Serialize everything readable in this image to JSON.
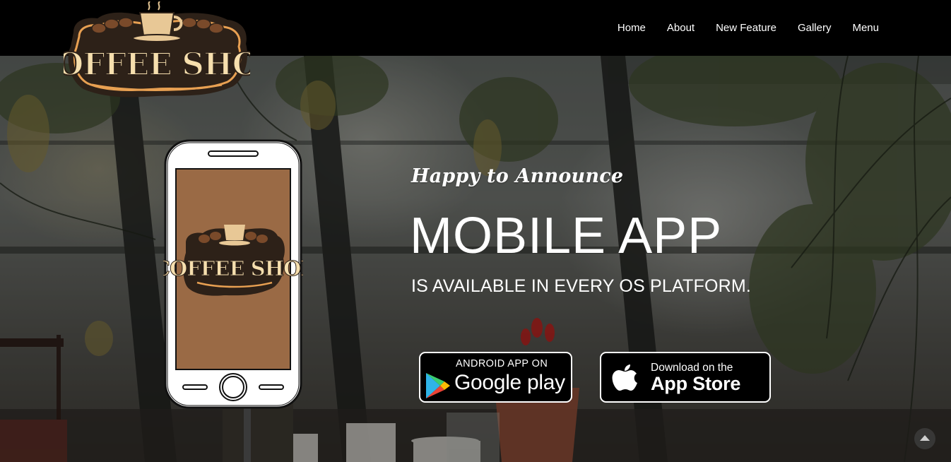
{
  "brand": {
    "logo_text": "COFFEE SHOP"
  },
  "nav": {
    "items": [
      {
        "label": "Home"
      },
      {
        "label": "About"
      },
      {
        "label": "New Feature"
      },
      {
        "label": "Gallery"
      },
      {
        "label": "Menu"
      }
    ]
  },
  "hero": {
    "kicker": "Happy to Announce",
    "headline": "MOBILE APP",
    "subline": "IS AVAILABLE IN EVERY OS PLATFORM."
  },
  "badges": {
    "google": {
      "small": "ANDROID APP ON",
      "big": "Google play",
      "icon": "google-play-icon"
    },
    "apple": {
      "small": "Download on the",
      "big": "App Store",
      "icon": "apple-icon"
    }
  },
  "phone": {
    "screen_logo_text": "COFFEE SHOP"
  },
  "scroll_top": {
    "icon": "chevron-up-icon"
  },
  "colors": {
    "nav_bg": "#000000",
    "phone_screen": "#9a6a45",
    "logo_cream": "#f6dfae",
    "logo_dark": "#2d2118",
    "logo_orange": "#e8a052"
  }
}
